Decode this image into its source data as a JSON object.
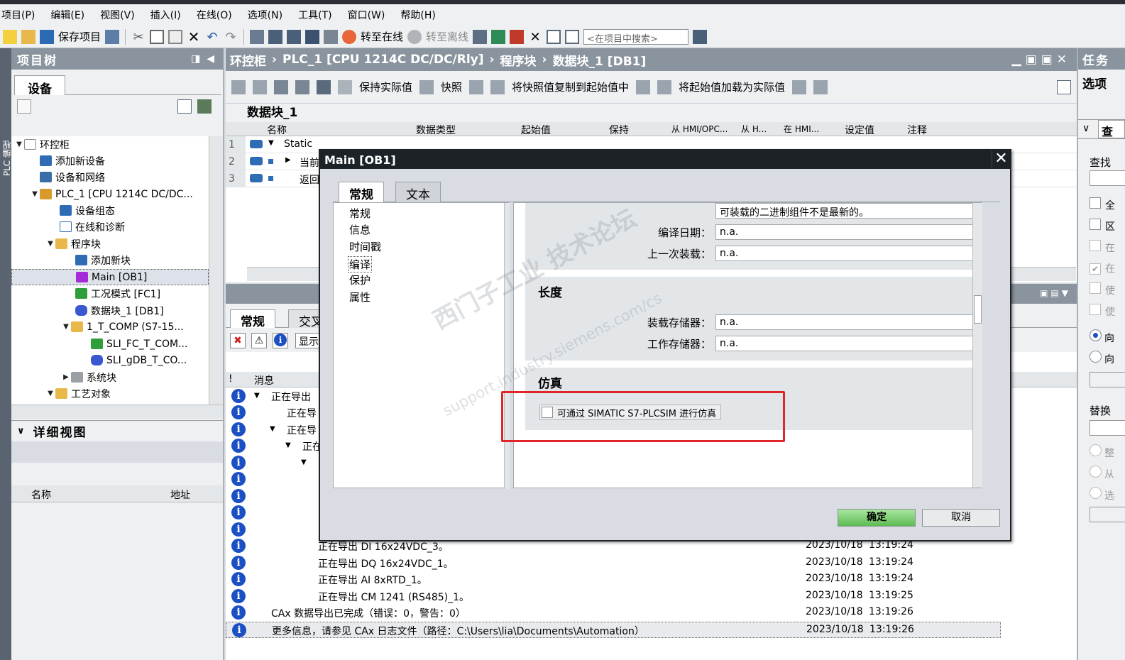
{
  "menu": [
    "项目(P)",
    "编辑(E)",
    "视图(V)",
    "插入(I)",
    "在线(O)",
    "选项(N)",
    "工具(T)",
    "窗口(W)",
    "帮助(H)"
  ],
  "toolbar": {
    "save_label": "保存项目",
    "go_online": "转至在线",
    "go_offline": "转至离线",
    "search_placeholder": "<在项目中搜索>"
  },
  "project_tree": {
    "title": "项目树",
    "tab": "设备",
    "side_label": "PLC 编程",
    "items": [
      "环控柜",
      "添加新设备",
      "设备和网络",
      "PLC_1 [CPU 1214C DC/DC...",
      "设备组态",
      "在线和诊断",
      "程序块",
      "添加新块",
      "Main [OB1]",
      "工况模式 [FC1]",
      "数据块_1 [DB1]",
      "1_T_COMP (S7-15...",
      "SLI_FC_T_COM...",
      "SLI_gDB_T_CO...",
      "系统块",
      "工艺对象"
    ],
    "detail_title": "详细视图",
    "detail_cols": [
      "名称",
      "地址"
    ]
  },
  "editor": {
    "breadcrumb": [
      "环控柜",
      "PLC_1 [CPU 1214C DC/DC/Rly]",
      "程序块",
      "数据块_1 [DB1]"
    ],
    "tool_labels": [
      "保持实际值",
      "快照",
      "将快照值复制到起始值中",
      "将起始值加载为实际值"
    ],
    "db_title": "数据块_1",
    "columns": [
      "名称",
      "数据类型",
      "起始值",
      "保持",
      "从 HMI/OPC...",
      "从 H...",
      "在 HMI...",
      "设定值",
      "注释"
    ],
    "rows": [
      {
        "num": "1",
        "name": "Static"
      },
      {
        "num": "2",
        "name": "当前"
      },
      {
        "num": "3",
        "name": "返回"
      }
    ]
  },
  "inspector": {
    "tabs": [
      "常规",
      "交叉"
    ],
    "show_label": "显示",
    "msg_header": "消息",
    "log_rows": [
      {
        "text": "正在导出",
        "date": "",
        "time": ""
      },
      {
        "text": "正在导",
        "date": "",
        "time": ""
      },
      {
        "text": "正在导",
        "date": "",
        "time": ""
      },
      {
        "text": "正在",
        "date": "",
        "time": ""
      },
      {
        "text": "",
        "date": "",
        "time": ""
      },
      {
        "text": "",
        "date": "",
        "time": ""
      },
      {
        "text": "",
        "date": "",
        "time": ""
      },
      {
        "text": "",
        "date": "",
        "time": ""
      },
      {
        "text": "",
        "date": "",
        "time": ""
      },
      {
        "text": "正在导出 DI 16x24VDC_3。",
        "date": "2023/10/18",
        "time": "13:19:24"
      },
      {
        "text": "正在导出 DQ 16x24VDC_1。",
        "date": "2023/10/18",
        "time": "13:19:24"
      },
      {
        "text": "正在导出 AI 8xRTD_1。",
        "date": "2023/10/18",
        "time": "13:19:24"
      },
      {
        "text": "正在导出 CM 1241 (RS485)_1。",
        "date": "2023/10/18",
        "time": "13:19:25"
      },
      {
        "text": "CAx 数据导出已完成（错误：0，警告：0）",
        "date": "2023/10/18",
        "time": "13:19:26"
      },
      {
        "text": "更多信息，请参见 CAx 日志文件（路径：C:\\Users\\lia\\Documents\\Automation）",
        "date": "2023/10/18",
        "time": "13:19:26"
      }
    ]
  },
  "right_pane": {
    "title": "任务",
    "options": "选项",
    "find": "查找",
    "replace": "替换",
    "frag": [
      "查",
      "全",
      "区",
      "在",
      "在",
      "使",
      "使",
      "向",
      "向",
      "整",
      "从",
      "选"
    ]
  },
  "dialog": {
    "title": "Main [OB1]",
    "tabs": [
      "常规",
      "文本"
    ],
    "nav": [
      "常规",
      "信息",
      "时间戳",
      "编译",
      "保护",
      "属性"
    ],
    "compile_status": "可装载的二进制组件不是最新的。",
    "compile_date_label": "编译日期：",
    "compile_date": "n.a.",
    "last_load_label": "上一次装载：",
    "last_load": "n.a.",
    "length_title": "长度",
    "load_mem_label": "装载存储器：",
    "load_mem": "n.a.",
    "work_mem_label": "工作存储器：",
    "work_mem": "n.a.",
    "sim_title": "仿真",
    "sim_checkbox": "可通过 SIMATIC S7-PLCSIM 进行仿真",
    "ok": "确定",
    "cancel": "取消",
    "close": "✕"
  },
  "watermark": {
    "line1": "西门子工业 技术论坛",
    "line2": "support.industry.siemens.com/cs"
  }
}
